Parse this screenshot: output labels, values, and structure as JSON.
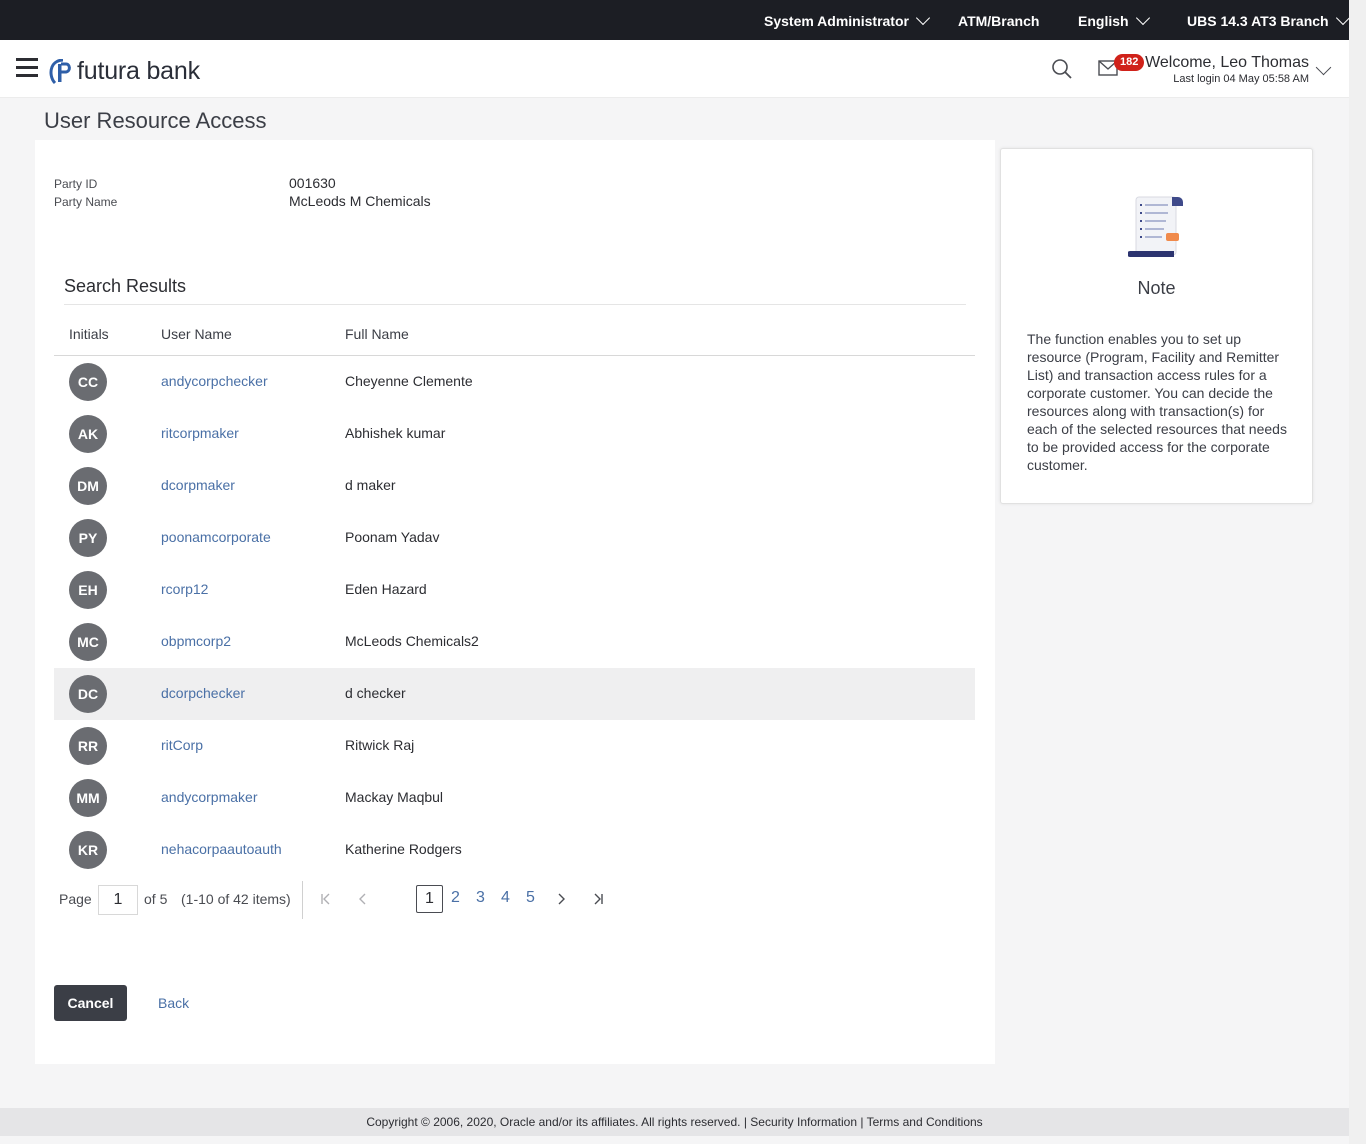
{
  "topbar": {
    "role": "System Administrator",
    "location": "ATM/Branch",
    "language": "English",
    "branch": "UBS 14.3 AT3 Branch"
  },
  "header": {
    "logo_text": "futura bank",
    "mail_count": "182",
    "welcome": "Welcome, Leo Thomas",
    "last_login": "Last login 04 May 05:58 AM"
  },
  "page": {
    "title": "User Resource Access"
  },
  "party": {
    "id_label": "Party ID",
    "id_value": "001630",
    "name_label": "Party Name",
    "name_value": "McLeods M Chemicals"
  },
  "results": {
    "title": "Search Results",
    "columns": [
      "Initials",
      "User Name",
      "Full Name"
    ],
    "rows": [
      {
        "initials": "CC",
        "username": "andycorpchecker",
        "fullname": "Cheyenne Clemente"
      },
      {
        "initials": "AK",
        "username": "ritcorpmaker",
        "fullname": "Abhishek kumar"
      },
      {
        "initials": "DM",
        "username": "dcorpmaker",
        "fullname": "d maker"
      },
      {
        "initials": "PY",
        "username": "poonamcorporate",
        "fullname": "Poonam Yadav"
      },
      {
        "initials": "EH",
        "username": "rcorp12",
        "fullname": "Eden Hazard"
      },
      {
        "initials": "MC",
        "username": "obpmcorp2",
        "fullname": "McLeods Chemicals2"
      },
      {
        "initials": "DC",
        "username": "dcorpchecker",
        "fullname": "d checker"
      },
      {
        "initials": "RR",
        "username": "ritCorp",
        "fullname": "Ritwick Raj"
      },
      {
        "initials": "MM",
        "username": "andycorpmaker",
        "fullname": "Mackay Maqbul"
      },
      {
        "initials": "KR",
        "username": "nehacorpaautoauth",
        "fullname": "Katherine Rodgers"
      }
    ]
  },
  "pager": {
    "page_label": "Page",
    "current": "1",
    "of_label": "of 5",
    "items_label": "(1-10 of 42 items)",
    "pages": [
      "1",
      "2",
      "3",
      "4",
      "5"
    ]
  },
  "actions": {
    "cancel": "Cancel",
    "back": "Back"
  },
  "note": {
    "title": "Note",
    "text": "The function enables you to set up resource (Program, Facility and Remitter List) and transaction access rules for a corporate customer. You can decide the resources along with transaction(s) for each of the selected resources that needs to be provided access for the corporate customer."
  },
  "footer": {
    "copyright": "Copyright © 2006, 2020, Oracle and/or its affiliates. All rights reserved.",
    "separator": "|",
    "security": "Security Information",
    "terms": "Terms and Conditions"
  },
  "colors": {
    "topbar": "#1c1e24",
    "link": "#4a70a6",
    "avatar": "#6a6c71",
    "badge": "#d0221a",
    "button": "#3b3e46"
  }
}
